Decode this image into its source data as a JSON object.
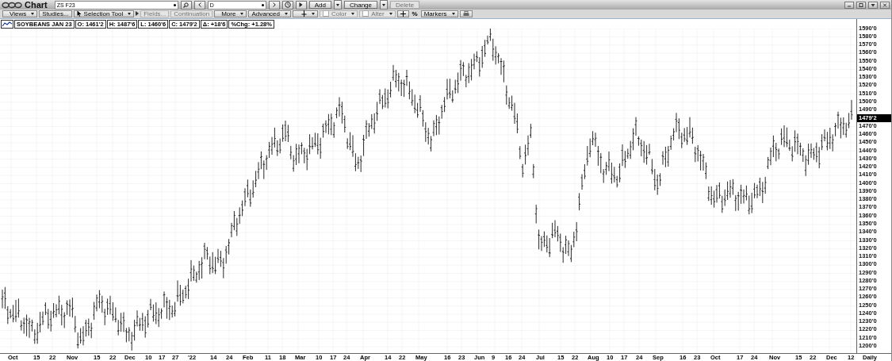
{
  "window": {
    "title": "Chart",
    "symbol": "ZS F23",
    "interval": "D",
    "buttons": [
      {
        "label": "Add",
        "disabled": false
      },
      {
        "label": "Change",
        "disabled": false
      },
      {
        "label": "Delete",
        "disabled": true
      }
    ]
  },
  "toolbar": {
    "items": [
      {
        "kind": "menu",
        "label": "Views",
        "disabled": false
      },
      {
        "kind": "button",
        "label": "Studies...",
        "disabled": false
      },
      {
        "kind": "tool-menu",
        "label": "Selection Tool",
        "disabled": false
      },
      {
        "kind": "arrow",
        "disabled": false
      },
      {
        "kind": "button",
        "label": "Fields...",
        "disabled": true
      },
      {
        "kind": "button",
        "label": "Continuation",
        "disabled": true
      },
      {
        "kind": "menu",
        "label": "More",
        "disabled": false
      },
      {
        "kind": "menu",
        "label": "Advanced",
        "disabled": false
      },
      {
        "kind": "cursor-menu",
        "disabled": false
      },
      {
        "kind": "swatch-menu",
        "label": "Color",
        "disabled": true
      },
      {
        "kind": "swatch-menu",
        "label": "Alter",
        "disabled": true
      },
      {
        "kind": "plus",
        "disabled": false
      },
      {
        "kind": "text",
        "label": "%",
        "disabled": false
      },
      {
        "kind": "menu",
        "label": "Markers",
        "disabled": false
      },
      {
        "kind": "print",
        "disabled": false
      }
    ]
  },
  "legend": {
    "name": "SOYBEANS JAN 23",
    "fields": [
      "O: 1461'2",
      "H: 1487'6",
      "L: 1460'6",
      "C: 1479'2",
      "Δ: +18'6",
      "%Chg: +1.28%"
    ]
  },
  "price_axis": {
    "labels": [
      {
        "text": "1590'0",
        "current": false
      },
      {
        "text": "1580'0",
        "current": false
      },
      {
        "text": "1570'0",
        "current": false
      },
      {
        "text": "1560'0",
        "current": false
      },
      {
        "text": "1550'0",
        "current": false
      },
      {
        "text": "1540'0",
        "current": false
      },
      {
        "text": "1530'0",
        "current": false
      },
      {
        "text": "1520'0",
        "current": false
      },
      {
        "text": "1510'0",
        "current": false
      },
      {
        "text": "1500'0",
        "current": false
      },
      {
        "text": "1490'0",
        "current": false
      },
      {
        "text": "1479'2",
        "current": true
      },
      {
        "text": "1470'0",
        "current": false
      },
      {
        "text": "1460'0",
        "current": false
      },
      {
        "text": "1450'0",
        "current": false
      },
      {
        "text": "1440'0",
        "current": false
      },
      {
        "text": "1430'0",
        "current": false
      },
      {
        "text": "1420'0",
        "current": false
      },
      {
        "text": "1410'0",
        "current": false
      },
      {
        "text": "1400'0",
        "current": false
      },
      {
        "text": "1390'0",
        "current": false
      },
      {
        "text": "1380'0",
        "current": false
      },
      {
        "text": "1370'0",
        "current": false
      },
      {
        "text": "1360'0",
        "current": false
      },
      {
        "text": "1350'0",
        "current": false
      },
      {
        "text": "1340'0",
        "current": false
      },
      {
        "text": "1330'0",
        "current": false
      },
      {
        "text": "1320'0",
        "current": false
      },
      {
        "text": "1310'0",
        "current": false
      },
      {
        "text": "1300'0",
        "current": false
      },
      {
        "text": "1290'0",
        "current": false
      },
      {
        "text": "1280'0",
        "current": false
      },
      {
        "text": "1270'0",
        "current": false
      },
      {
        "text": "1260'0",
        "current": false
      },
      {
        "text": "1250'0",
        "current": false
      },
      {
        "text": "1240'0",
        "current": false
      },
      {
        "text": "1230'0",
        "current": false
      },
      {
        "text": "1220'0",
        "current": false
      },
      {
        "text": "1210'0",
        "current": false
      },
      {
        "text": "1200'0",
        "current": false
      }
    ]
  },
  "time_axis": {
    "labels": [
      "Oct",
      "15",
      "22",
      "Nov",
      "15",
      "22",
      "Dec",
      "10",
      "17",
      "27",
      "'22",
      "14",
      "24",
      "Feb",
      "11",
      "18",
      "Mar",
      "10",
      "17",
      "24",
      "Apr",
      "14",
      "22",
      "May",
      "16",
      "23",
      "Jun",
      "9",
      "16",
      "24",
      "Jul",
      "15",
      "22",
      "Aug",
      "10",
      "17",
      "24",
      "Sep",
      "16",
      "23",
      "Oct",
      "17",
      "24",
      "Nov",
      "15",
      "22",
      "Dec",
      "12"
    ],
    "period": "Daily"
  }
}
